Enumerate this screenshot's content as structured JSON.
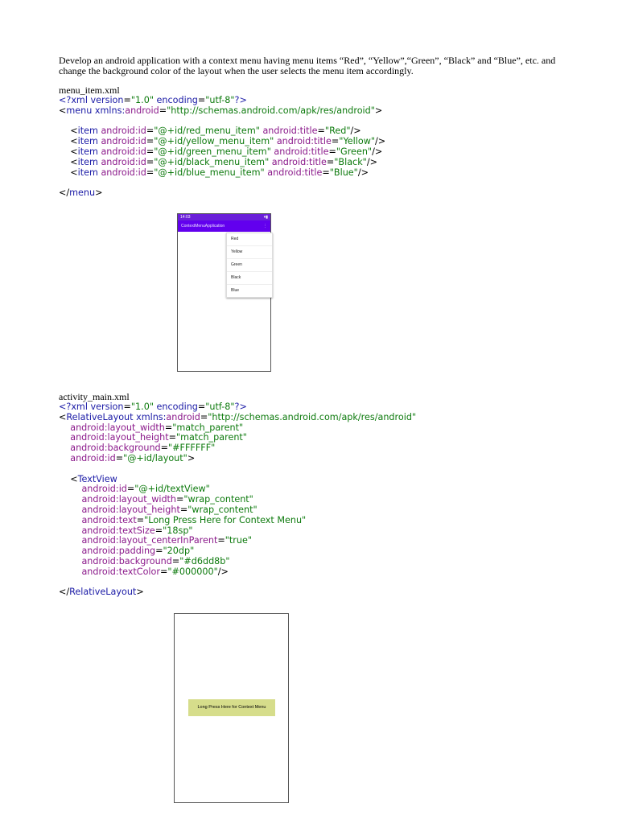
{
  "intro": "Develop an android application with a context menu having menu items “Red”, “Yellow”,“Green”, “Black” and “Blue”, etc. and change the background color of the layout when the user selects the menu item accordingly.",
  "menu_section": {
    "filename": "menu_item.xml",
    "xml_decl": {
      "open": "<?",
      "name": "xml",
      "version_attr": "version",
      "version_val": "\"1.0\"",
      "enc_attr": "encoding",
      "enc_val": "\"utf-8\"",
      "close": "?>"
    },
    "menu_open": {
      "lt": "<",
      "tag": "menu",
      "xmlns_attr": "xmlns:",
      "xmlns_ns": "android",
      "eq": "=",
      "xmlns_val": "\"http://schemas.android.com/apk/res/android\"",
      "gt": ">"
    },
    "items": [
      {
        "id": "\"@+id/red_menu_item\"",
        "title": "\"Red\""
      },
      {
        "id": "\"@+id/yellow_menu_item\"",
        "title": "\"Yellow\""
      },
      {
        "id": "\"@+id/green_menu_item\"",
        "title": "\"Green\""
      },
      {
        "id": "\"@+id/black_menu_item\"",
        "title": "\"Black\""
      },
      {
        "id": "\"@+id/blue_menu_item\"",
        "title": "\"Blue\""
      }
    ],
    "menu_close": {
      "lt": "</",
      "tag": "menu",
      "gt": ">"
    }
  },
  "phone1": {
    "status_time": "14:03",
    "status_icons": "▾▮",
    "app_title": "ContextMenuApplication",
    "overflow": "⋮",
    "menu_items": [
      "Red",
      "Yellow",
      "Green",
      "Black",
      "Blue"
    ]
  },
  "activity_section": {
    "filename": "activity_main.xml",
    "layout_tag": "RelativeLayout",
    "layout_xmlns_val": "\"http://schemas.android.com/apk/res/android\"",
    "layout_attrs": [
      {
        "name": "layout_width",
        "val": "\"match_parent\""
      },
      {
        "name": "layout_height",
        "val": "\"match_parent\""
      },
      {
        "name": "background",
        "val": "\"#FFFFFF\""
      },
      {
        "name": "id",
        "val": "\"@+id/layout\""
      }
    ],
    "textview_tag": "TextView",
    "textview_attrs": [
      {
        "name": "id",
        "val": "\"@+id/textView\""
      },
      {
        "name": "layout_width",
        "val": "\"wrap_content\""
      },
      {
        "name": "layout_height",
        "val": "\"wrap_content\""
      },
      {
        "name": "text",
        "val": "\"Long Press Here for Context Menu\""
      },
      {
        "name": "textSize",
        "val": "\"18sp\""
      },
      {
        "name": "layout_centerInParent",
        "val": "\"true\""
      },
      {
        "name": "padding",
        "val": "\"20dp\""
      },
      {
        "name": "background",
        "val": "\"#d6dd8b\""
      },
      {
        "name": "textColor",
        "val": "\"#000000\""
      }
    ]
  },
  "phone2": {
    "textview_text": "Long Press Here for Context Menu"
  },
  "colors": {
    "tag": "#1a1aa6",
    "attr": "#8b1a8b",
    "string": "#0d7a0d",
    "app_bar": "#6200ee",
    "textview_bg": "#d6dd8b"
  }
}
